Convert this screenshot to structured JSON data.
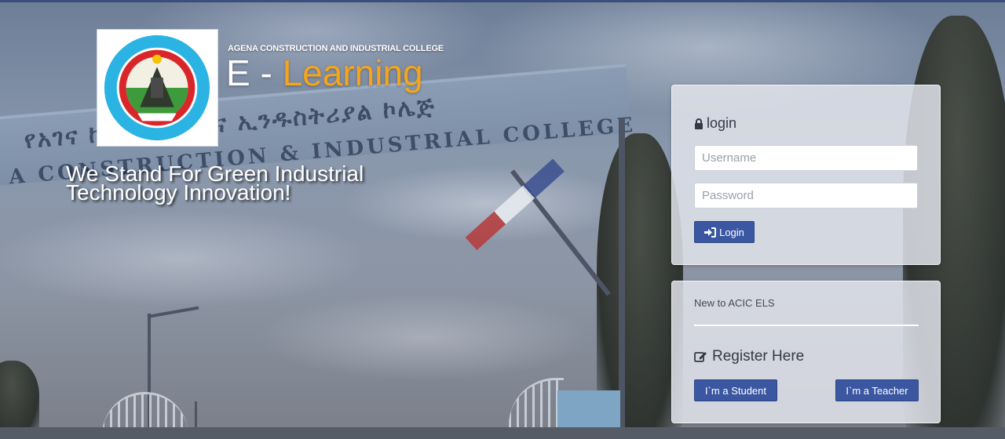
{
  "brand": {
    "college_name": "AGENA CONSTRUCTION AND INDUSTRIAL COLLEGE",
    "title_prefix": "E",
    "title_separator": "-",
    "title_main": "Learning",
    "logo_alt": "AGENA CONSTRUCTION & INDUSTRIAL COLLEGE",
    "tagline": "We Stand For Green Industrial Technology Innovation!"
  },
  "background": {
    "arch_line_1": "የአገና ኮንስትራክሽንና ኢንዱስትሪያል ኮሌጅ",
    "arch_line_2": "A CONSTRUCTION & INDUSTRIAL COLLEGE"
  },
  "login": {
    "heading": "login",
    "username_placeholder": "Username",
    "password_placeholder": "Password",
    "button_label": "Login"
  },
  "register": {
    "new_to": "New to ACIC ELS",
    "heading": "Register Here",
    "student_button": "I`m a Student",
    "teacher_button": "I`m a Teacher"
  },
  "colors": {
    "accent_orange": "#f6a51a",
    "button_blue": "#3b57a2",
    "top_stripe": "#3a4f7a"
  },
  "icons": {
    "login_heading": "lock-icon",
    "login_button": "sign-in-icon",
    "register_heading": "edit-icon"
  }
}
